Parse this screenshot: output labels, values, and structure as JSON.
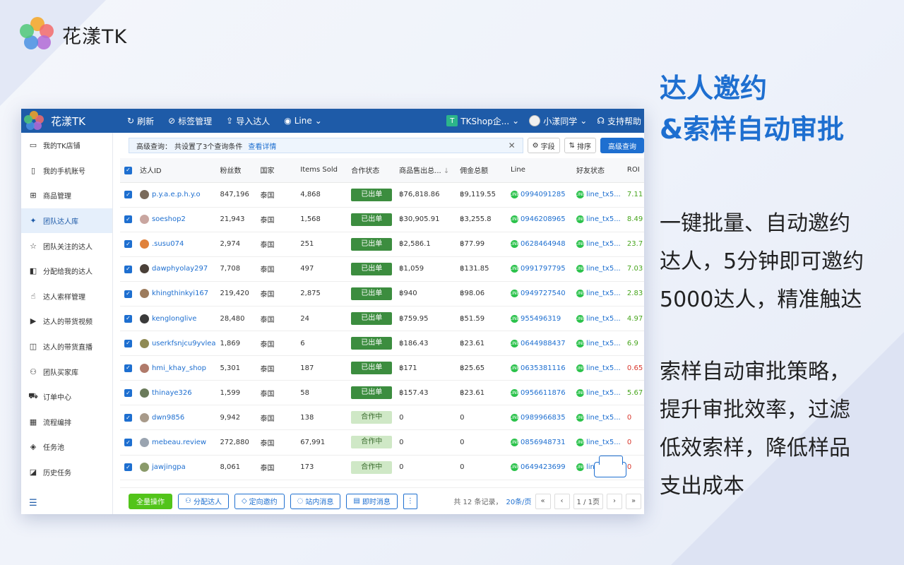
{
  "brand": {
    "name": "花漾TK"
  },
  "window": {
    "app_name": "花漾TK",
    "toolbar": [
      {
        "icon": "refresh-icon",
        "glyph": "↻",
        "label": "刷新"
      },
      {
        "icon": "tag-icon",
        "glyph": "⊘",
        "label": "标签管理"
      },
      {
        "icon": "import-icon",
        "glyph": "⇪",
        "label": "导入达人"
      },
      {
        "icon": "eye-icon",
        "glyph": "◉",
        "label": "Line"
      }
    ],
    "shop_label": "TKShop企...",
    "shop_badge": "T",
    "user_label": "小漾同学",
    "help_label": "支持帮助"
  },
  "sidebar": {
    "items": [
      {
        "icon": "store-icon",
        "glyph": "▭",
        "label": "我的TK店铺"
      },
      {
        "icon": "phone-icon",
        "glyph": "▯",
        "label": "我的手机账号"
      },
      {
        "icon": "cart-icon",
        "glyph": "⊞",
        "label": "商品管理"
      },
      {
        "icon": "team-icon",
        "glyph": "✦",
        "label": "团队达人库",
        "active": true
      },
      {
        "icon": "star-icon",
        "glyph": "☆",
        "label": "团队关注的达人"
      },
      {
        "icon": "assign-icon",
        "glyph": "◧",
        "label": "分配给我的达人"
      },
      {
        "icon": "hand-icon",
        "glyph": "☝",
        "label": "达人索样管理"
      },
      {
        "icon": "video-icon",
        "glyph": "▶",
        "label": "达人的带货视频"
      },
      {
        "icon": "live-icon",
        "glyph": "◫",
        "label": "达人的带货直播"
      },
      {
        "icon": "buyer-icon",
        "glyph": "⚇",
        "label": "团队买家库"
      },
      {
        "icon": "truck-icon",
        "glyph": "⛟",
        "label": "订单中心"
      },
      {
        "icon": "calendar-icon",
        "glyph": "▦",
        "label": "流程编排"
      },
      {
        "icon": "layers-icon",
        "glyph": "◈",
        "label": "任务池"
      },
      {
        "icon": "history-icon",
        "glyph": "◪",
        "label": "历史任务"
      }
    ],
    "collapse_glyph": "☰"
  },
  "query": {
    "label": "高级查询：",
    "text": "共设置了3个查询条件",
    "link": "查看详情",
    "field_button": "字段",
    "sort_button": "排序",
    "advanced_button": "高级查询"
  },
  "table": {
    "headers": [
      "达人ID",
      "粉丝数",
      "国家",
      "Items Sold",
      "合作状态",
      "商品售出总...",
      "佣金总额",
      "Line",
      "好友状态",
      "ROI"
    ],
    "rows": [
      {
        "id": "p.y.a.e.p.h.y.o",
        "fans": "847,196",
        "country": "泰国",
        "sold": "4,868",
        "status": "已出单",
        "status_type": "done",
        "gmv": "฿76,818.86",
        "commission": "฿9,119.55",
        "line": "0994091285",
        "friend": "line_tx5...",
        "roi": "7.11",
        "roi_type": "g",
        "avatar_color": "#7a6a5a"
      },
      {
        "id": "soeshop2",
        "fans": "21,943",
        "country": "泰国",
        "sold": "1,568",
        "status": "已出单",
        "status_type": "done",
        "gmv": "฿30,905.91",
        "commission": "฿3,255.8",
        "line": "0946208965",
        "friend": "line_tx5...",
        "roi": "8.49",
        "roi_type": "g",
        "avatar_color": "#c9a6a0"
      },
      {
        "id": ".susu074",
        "fans": "2,974",
        "country": "泰国",
        "sold": "251",
        "status": "已出单",
        "status_type": "done",
        "gmv": "฿2,586.1",
        "commission": "฿77.99",
        "line": "0628464948",
        "friend": "line_tx5...",
        "roi": "23.7",
        "roi_type": "g",
        "avatar_color": "#e0813a"
      },
      {
        "id": "dawphyolay297",
        "fans": "7,708",
        "country": "泰国",
        "sold": "497",
        "status": "已出单",
        "status_type": "done",
        "gmv": "฿1,059",
        "commission": "฿131.85",
        "line": "0991797795",
        "friend": "line_tx5...",
        "roi": "7.03",
        "roi_type": "g",
        "avatar_color": "#4a4038"
      },
      {
        "id": "khingthinkyi167",
        "fans": "219,420",
        "country": "泰国",
        "sold": "2,875",
        "status": "已出单",
        "status_type": "done",
        "gmv": "฿940",
        "commission": "฿98.06",
        "line": "0949727540",
        "friend": "line_tx5...",
        "roi": "2.83",
        "roi_type": "g",
        "avatar_color": "#9c7b5c"
      },
      {
        "id": "kenglonglive",
        "fans": "28,480",
        "country": "泰国",
        "sold": "24",
        "status": "已出单",
        "status_type": "done",
        "gmv": "฿759.95",
        "commission": "฿51.59",
        "line": "955496319",
        "friend": "line_tx5...",
        "roi": "4.97",
        "roi_type": "g",
        "avatar_color": "#3a3a3a"
      },
      {
        "id": "userkfsnjcu9yvlea",
        "fans": "1,869",
        "country": "泰国",
        "sold": "6",
        "status": "已出单",
        "status_type": "done",
        "gmv": "฿186.43",
        "commission": "฿23.61",
        "line": "0644988437",
        "friend": "line_tx5...",
        "roi": "6.9",
        "roi_type": "g",
        "avatar_color": "#8f8a54"
      },
      {
        "id": "hmi_khay_shop",
        "fans": "5,301",
        "country": "泰国",
        "sold": "187",
        "status": "已出单",
        "status_type": "done",
        "gmv": "฿171",
        "commission": "฿25.65",
        "line": "0635381116",
        "friend": "line_tx5...",
        "roi": "0.65",
        "roi_type": "r",
        "avatar_color": "#b07a6a"
      },
      {
        "id": "thinaye326",
        "fans": "1,599",
        "country": "泰国",
        "sold": "58",
        "status": "已出单",
        "status_type": "done",
        "gmv": "฿157.43",
        "commission": "฿23.61",
        "line": "0956611876",
        "friend": "line_tx5...",
        "roi": "5.67",
        "roi_type": "g",
        "avatar_color": "#6a7a5a"
      },
      {
        "id": "dwn9856",
        "fans": "9,942",
        "country": "泰国",
        "sold": "138",
        "status": "合作中",
        "status_type": "coop",
        "gmv": "0",
        "commission": "0",
        "line": "0989966835",
        "friend": "line_tx5...",
        "roi": "0",
        "roi_type": "r",
        "avatar_color": "#a89a8a"
      },
      {
        "id": "mebeau.review",
        "fans": "272,880",
        "country": "泰国",
        "sold": "67,991",
        "status": "合作中",
        "status_type": "coop",
        "gmv": "0",
        "commission": "0",
        "line": "0856948731",
        "friend": "line_tx5...",
        "roi": "0",
        "roi_type": "r",
        "avatar_color": "#9aa4b0"
      },
      {
        "id": "jawjingpa",
        "fans": "8,061",
        "country": "泰国",
        "sold": "173",
        "status": "合作中",
        "status_type": "coop",
        "gmv": "0",
        "commission": "0",
        "line": "0649423699",
        "friend": "lin",
        "roi": "0",
        "roi_type": "r",
        "avatar_color": "#8a9a6a"
      }
    ]
  },
  "footer": {
    "bulk_button": "全量操作",
    "buttons": [
      {
        "icon": "user-icon",
        "glyph": "⚇",
        "label": "分配达人"
      },
      {
        "icon": "tag-icon",
        "glyph": "◇",
        "label": "定向邀约"
      },
      {
        "icon": "message-icon",
        "glyph": "◌",
        "label": "站内消息"
      },
      {
        "icon": "instant-message-icon",
        "glyph": "▤",
        "label": "即时消息"
      }
    ],
    "more_glyph": "⋮",
    "total_text": "共 12 条记录，",
    "page_size": "20条/页",
    "page_text": "1 / 1页"
  },
  "right": {
    "headline1": "达人邀约",
    "headline2": "&索样自动审批",
    "para1": [
      "一键批量、自动邀约",
      "达人，5分钟即可邀约",
      "5000达人，精准触达"
    ],
    "para2": [
      "索样自动审批策略，",
      "提升审批效率，过滤",
      "低效索样，降低样品",
      "支出成本"
    ]
  },
  "colors": {
    "primary": "#1e6fd0",
    "titlebar": "#1e5ba8",
    "done": "#3c8d3f",
    "coop": "#cfe8c6",
    "line_green": "#2bc24b"
  }
}
